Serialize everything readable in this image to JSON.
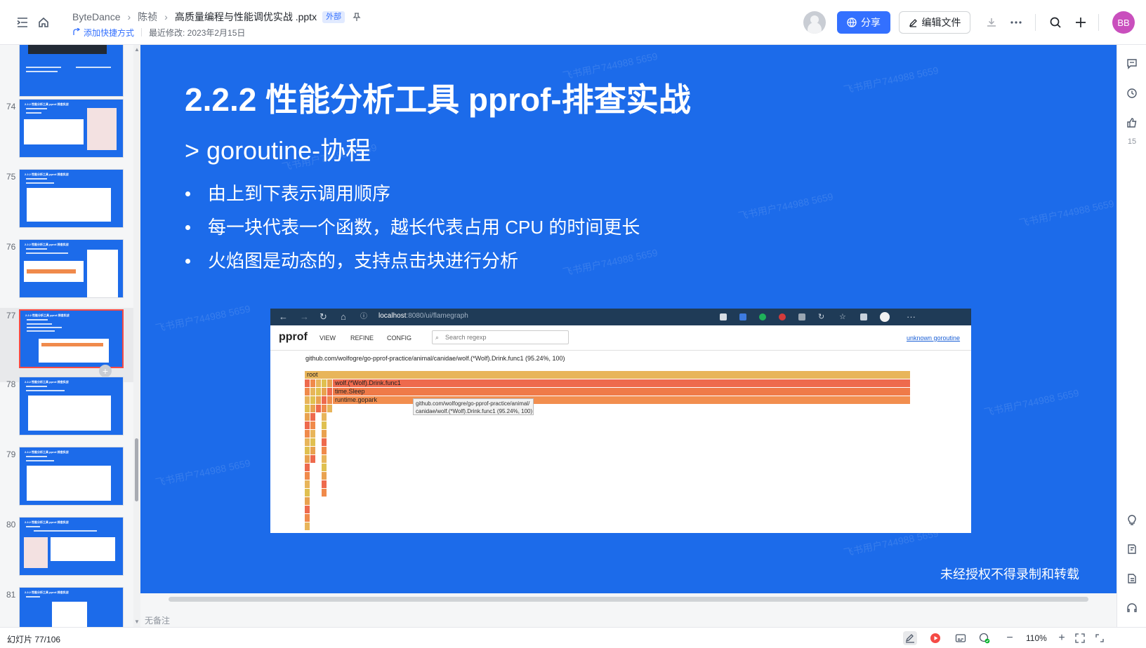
{
  "header": {
    "breadcrumb": [
      "ByteDance",
      "陈祯",
      "高质量编程与性能调优实战 .pptx"
    ],
    "external_badge": "外部",
    "add_shortcut": "添加快捷方式",
    "last_modified": "最近修改: 2023年2月15日",
    "share_label": "分享",
    "edit_label": "编辑文件",
    "user_initials": "BB"
  },
  "thumbnails": {
    "items": [
      {
        "num": "",
        "title": ""
      },
      {
        "num": "74",
        "title": "2.2.2 性能分析工具 pprof-排查实战"
      },
      {
        "num": "75",
        "title": "2.2.2 性能分析工具 pprof-排查实战"
      },
      {
        "num": "76",
        "title": "2.2.2 性能分析工具 pprof-排查实战"
      },
      {
        "num": "77",
        "title": "2.2.2 性能分析工具 pprof-排查实战",
        "active": true
      },
      {
        "num": "78",
        "title": "2.2.2 性能分析工具 pprof-排查实战"
      },
      {
        "num": "79",
        "title": "2.2.2 性能分析工具 pprof-排查实战"
      },
      {
        "num": "80",
        "title": "2.2.2 性能分析工具 pprof-排查实战"
      },
      {
        "num": "81",
        "title": "2.2.2 性能分析工具 pprof-排查实战"
      }
    ]
  },
  "slide": {
    "title": "2.2.2 性能分析工具 pprof-排查实战",
    "subtitle": "> goroutine-协程",
    "bullets": [
      "由上到下表示调用顺序",
      "每一块代表一个函数，越长代表占用 CPU 的时间更长",
      "火焰图是动态的，支持点击块进行分析"
    ],
    "notice": "未经授权不得录制和转载",
    "watermark": "飞书用户744988 5659",
    "screenshot": {
      "url_host": "localhost",
      "url_rest": ":8080/ui/flamegraph",
      "logo": "pprof",
      "menu": [
        "VIEW",
        "REFINE",
        "CONFIG"
      ],
      "search_placeholder": "Search regexp",
      "right_link": "unknown goroutine",
      "heading": "github.com/wolfogre/go-pprof-practice/animal/canidae/wolf.(*Wolf).Drink.func1 (95.24%, 100)",
      "frames": [
        "root",
        "wolf.(*Wolf).Drink.func1",
        "time.Sleep",
        "runtime.gopark"
      ],
      "tooltip_line1": "github.com/wolfogre/go-pprof-practice/animal/",
      "tooltip_line2": "canidae/wolf.(*Wolf).Drink.func1 (95.24%, 100)"
    }
  },
  "notes_placeholder": "无备注",
  "rail": {
    "like_count": "15"
  },
  "status": {
    "slide_count": "幻灯片 77/106",
    "zoom": "110%"
  }
}
